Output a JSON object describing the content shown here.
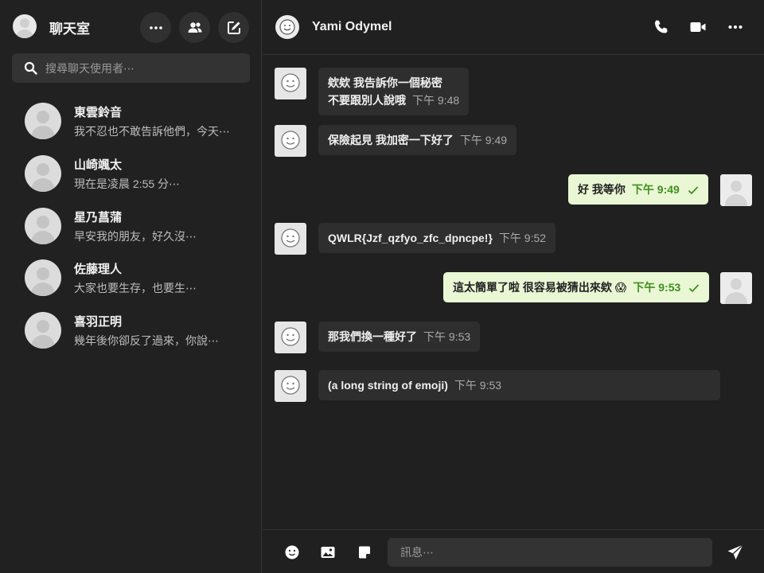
{
  "sidebar": {
    "title": "聊天室",
    "search_placeholder": "搜尋聊天使用者⋯",
    "contacts": [
      {
        "name": "東雲鈴音",
        "preview": "我不忍也不敢告訴他們，今天⋯"
      },
      {
        "name": "山崎颯太",
        "preview": "現在是凌晨 2:55 分⋯"
      },
      {
        "name": "星乃菖蒲",
        "preview": "早安我的朋友，好久沒⋯"
      },
      {
        "name": "佐藤理人",
        "preview": "大家也要生存，也要生⋯"
      },
      {
        "name": "喜羽正明",
        "preview": "幾年後你卻反了過來，你說⋯"
      }
    ]
  },
  "chat": {
    "peer_name": "Yami Odymel",
    "messages": [
      {
        "side": "in",
        "lines": [
          "欸欸 我告訴你一個秘密",
          "不要跟別人說哦"
        ],
        "time": "下午 9:48"
      },
      {
        "side": "in",
        "lines": [
          "保險起見 我加密一下好了"
        ],
        "time": "下午 9:49"
      },
      {
        "side": "out",
        "lines": [
          "好 我等你"
        ],
        "time": "下午 9:49"
      },
      {
        "side": "in",
        "lines": [
          "QWLR{Jzf_qzfyo_zfc_dpncpe!}"
        ],
        "time": "下午 9:52"
      },
      {
        "side": "out",
        "lines": [
          "這太簡單了啦 很容易被猜出來欸 😱"
        ],
        "time": "下午 9:53"
      },
      {
        "side": "in",
        "lines": [
          "那我們換一種好了"
        ],
        "time": "下午 9:53"
      },
      {
        "side": "in",
        "lines": [
          "(a long string of emoji)"
        ],
        "time": "下午 9:53"
      }
    ]
  },
  "composer": {
    "placeholder": "訊息⋯"
  },
  "icons": {
    "more": "more-horizontal-icon",
    "users": "users-icon",
    "compose": "compose-icon",
    "phone": "phone-icon",
    "video": "video-icon",
    "emoji": "smiley-icon",
    "image": "image-icon",
    "sticker": "sticker-icon",
    "send": "send-icon",
    "check": "check-icon"
  }
}
